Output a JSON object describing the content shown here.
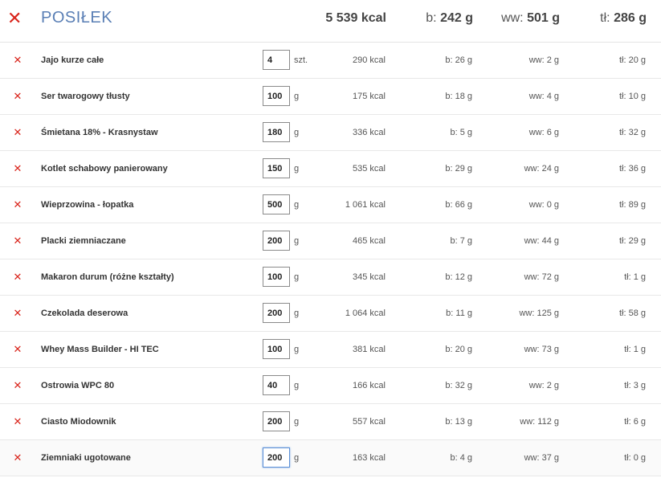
{
  "header": {
    "remove_icon": "close-icon",
    "title": "POSIŁEK",
    "kcal": "5 539 kcal",
    "b_label": "b:",
    "b_value": "242 g",
    "ww_label": "ww:",
    "ww_value": "501 g",
    "tl_label": "tł:",
    "tl_value": "286 g"
  },
  "colors": {
    "title": "#5a7fb5",
    "remove": "#d9241b",
    "active_input_border": "#5b8fd6"
  },
  "items": [
    {
      "name": "Jajo kurze całe",
      "qty": "4",
      "unit": "szt.",
      "kcal": "290 kcal",
      "b": "b: 26 g",
      "ww": "ww: 2 g",
      "tl": "tł: 20 g"
    },
    {
      "name": "Ser twarogowy tłusty",
      "qty": "100",
      "unit": "g",
      "kcal": "175 kcal",
      "b": "b: 18 g",
      "ww": "ww: 4 g",
      "tl": "tł: 10 g"
    },
    {
      "name": "Śmietana 18% - Krasnystaw",
      "qty": "180",
      "unit": "g",
      "kcal": "336 kcal",
      "b": "b: 5 g",
      "ww": "ww: 6 g",
      "tl": "tł: 32 g"
    },
    {
      "name": "Kotlet schabowy panierowany",
      "qty": "150",
      "unit": "g",
      "kcal": "535 kcal",
      "b": "b: 29 g",
      "ww": "ww: 24 g",
      "tl": "tł: 36 g"
    },
    {
      "name": "Wieprzowina - łopatka",
      "qty": "500",
      "unit": "g",
      "kcal": "1 061 kcal",
      "b": "b: 66 g",
      "ww": "ww: 0 g",
      "tl": "tł: 89 g"
    },
    {
      "name": "Placki ziemniaczane",
      "qty": "200",
      "unit": "g",
      "kcal": "465 kcal",
      "b": "b: 7 g",
      "ww": "ww: 44 g",
      "tl": "tł: 29 g"
    },
    {
      "name": "Makaron durum (różne kształty)",
      "qty": "100",
      "unit": "g",
      "kcal": "345 kcal",
      "b": "b: 12 g",
      "ww": "ww: 72 g",
      "tl": "tł: 1 g"
    },
    {
      "name": "Czekolada deserowa",
      "qty": "200",
      "unit": "g",
      "kcal": "1 064 kcal",
      "b": "b: 11 g",
      "ww": "ww: 125 g",
      "tl": "tł: 58 g"
    },
    {
      "name": "Whey Mass Builder - HI TEC",
      "qty": "100",
      "unit": "g",
      "kcal": "381 kcal",
      "b": "b: 20 g",
      "ww": "ww: 73 g",
      "tl": "tł: 1 g"
    },
    {
      "name": "Ostrowia WPC 80",
      "qty": "40",
      "unit": "g",
      "kcal": "166 kcal",
      "b": "b: 32 g",
      "ww": "ww: 2 g",
      "tl": "tł: 3 g"
    },
    {
      "name": "Ciasto Miodownik",
      "qty": "200",
      "unit": "g",
      "kcal": "557 kcal",
      "b": "b: 13 g",
      "ww": "ww: 112 g",
      "tl": "tł: 6 g"
    },
    {
      "name": "Ziemniaki ugotowane",
      "qty": "200",
      "unit": "g",
      "kcal": "163 kcal",
      "b": "b: 4 g",
      "ww": "ww: 37 g",
      "tl": "tł: 0 g"
    }
  ]
}
